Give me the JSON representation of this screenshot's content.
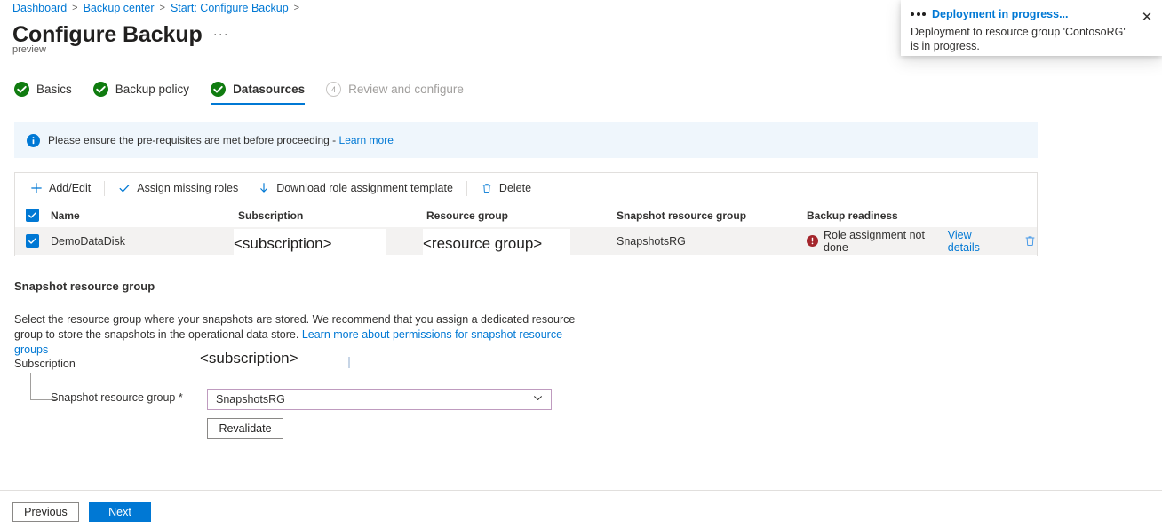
{
  "breadcrumb": {
    "items": [
      {
        "label": "Dashboard"
      },
      {
        "label": "Backup center"
      },
      {
        "label": "Start: Configure Backup"
      }
    ],
    "separator": ">"
  },
  "header": {
    "title": "Configure Backup",
    "ellipsis": "···",
    "preview_tag": "preview"
  },
  "wizard": {
    "steps": [
      {
        "label": "Basics",
        "state": "complete",
        "icon": "check-circle-icon"
      },
      {
        "label": "Backup policy",
        "state": "complete",
        "icon": "check-circle-icon"
      },
      {
        "label": "Datasources",
        "state": "active",
        "icon": "check-circle-icon"
      },
      {
        "label": "Review and configure",
        "state": "pending",
        "number": "4"
      }
    ]
  },
  "info_banner": {
    "icon": "info-icon",
    "text": "Please ensure the pre-requisites are met before proceeding - ",
    "link": "Learn more"
  },
  "toolbar": {
    "buttons": [
      {
        "label": "Add/Edit",
        "icon": "plus-icon"
      },
      {
        "label": "Assign missing roles",
        "icon": "check-icon"
      },
      {
        "label": "Download role assignment template",
        "icon": "download-arrow-icon"
      },
      {
        "label": "Delete",
        "icon": "trash-icon"
      }
    ]
  },
  "table": {
    "select_all_checked": true,
    "columns": [
      "Name",
      "Subscription",
      "Resource group",
      "Snapshot resource group",
      "Backup readiness"
    ],
    "rows": [
      {
        "checked": true,
        "name": "DemoDataDisk",
        "subscription": "",
        "resource_group": "",
        "snapshot_resource_group": "SnapshotsRG",
        "backup_readiness": "Role assignment not done",
        "readiness_status": "error",
        "view_details": "View details",
        "delete_icon": "trash-icon"
      }
    ]
  },
  "overlays": {
    "row_subscription": "<subscription>",
    "row_resource_group": "<resource group>",
    "form_subscription": "<subscription>"
  },
  "snapshot_section": {
    "title": "Snapshot resource group",
    "description": "Select the resource group where your snapshots are stored. We recommend that you assign a dedicated resource group to store the snapshots in the operational data store. ",
    "description_link": "Learn more about permissions for snapshot resource groups",
    "subscription_label": "Subscription",
    "snapshot_rg_label": "Snapshot resource group *",
    "snapshot_rg_value": "SnapshotsRG",
    "revalidate_label": "Revalidate"
  },
  "footer": {
    "previous_label": "Previous",
    "next_label": "Next"
  },
  "toast": {
    "title": "Deployment in progress...",
    "body": "Deployment to resource group 'ContosoRG' is in progress.",
    "close_icon": "close-icon",
    "status_icon": "ellipsis-progress-icon"
  },
  "colors": {
    "accent": "#0078d4",
    "success": "#107c10",
    "error": "#a4262c",
    "dropdown_border": "#bf9bbf",
    "row_bg": "#f3f2f1",
    "info_bg": "#eff6fc"
  }
}
